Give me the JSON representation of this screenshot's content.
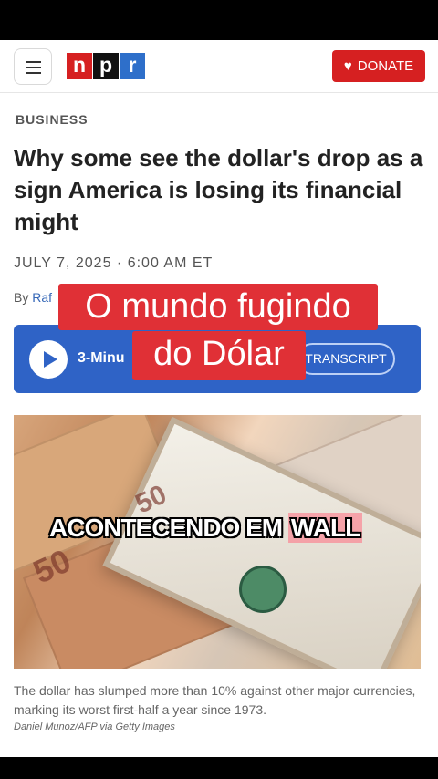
{
  "header": {
    "logo": [
      "n",
      "p",
      "r"
    ],
    "logo_colors": [
      "#d62021",
      "#111111",
      "#2e6fca"
    ],
    "donate_label": "DONATE",
    "donate_icon": "heart-icon",
    "menu_icon": "hamburger-menu-icon"
  },
  "article": {
    "section": "BUSINESS",
    "headline": "Why some see the dollar's drop as a sign America is losing its financial might",
    "date": "JULY 7, 2025 · 6:00 AM ET",
    "byline_prefix": "By ",
    "byline_author": "Raf"
  },
  "player": {
    "listen_label": "3-Minu",
    "transcript_label": "TRANSCRIPT",
    "play_icon": "play-icon"
  },
  "image": {
    "description": "Euro and US dollar banknotes",
    "euro_label": "50",
    "caption": "The dollar has slumped more than 10% against other major currencies, marking its worst first-half a year since 1973.",
    "credit": "Daniel Munoz/AFP via Getty Images"
  },
  "overlays": {
    "line1": "O mundo fugindo",
    "line2": "do Dólar",
    "wall_text": "ACONTECENDO EM ",
    "wall_highlight": "WALL"
  }
}
